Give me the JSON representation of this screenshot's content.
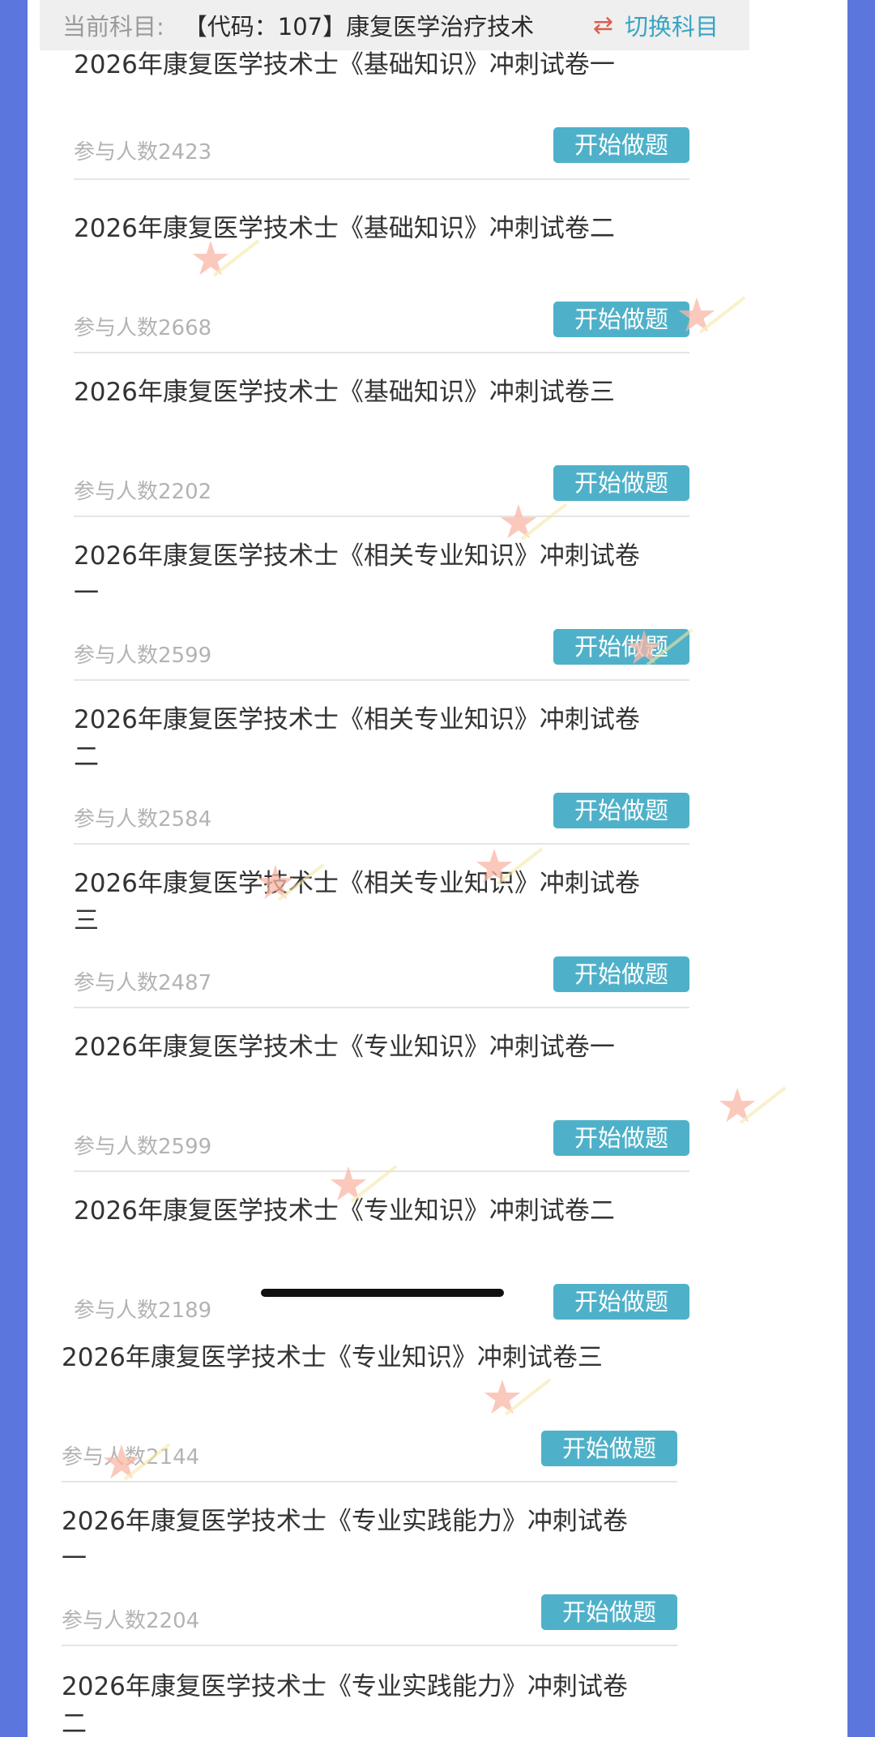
{
  "header": {
    "label": "当前科目:",
    "subject": "【代码：107】康复医学治疗技术",
    "switch_icon": "⇄",
    "switch_label": "切换科目"
  },
  "items": [
    {
      "title": "2026年康复医学技术士《基础知识》冲刺试卷一",
      "count": "参与人数2423",
      "button": "开始做题"
    },
    {
      "title": "2026年康复医学技术士《基础知识》冲刺试卷二",
      "count": "参与人数2668",
      "button": "开始做题"
    },
    {
      "title": "2026年康复医学技术士《基础知识》冲刺试卷三",
      "count": "参与人数2202",
      "button": "开始做题"
    },
    {
      "title": "2026年康复医学技术士《相关专业知识》冲刺试卷一",
      "count": "参与人数2599",
      "button": "开始做题"
    },
    {
      "title": "2026年康复医学技术士《相关专业知识》冲刺试卷二",
      "count": "参与人数2584",
      "button": "开始做题"
    },
    {
      "title": "2026年康复医学技术士《相关专业知识》冲刺试卷三",
      "count": "参与人数2487",
      "button": "开始做题"
    },
    {
      "title": "2026年康复医学技术士《专业知识》冲刺试卷一",
      "count": "参与人数2599",
      "button": "开始做题"
    },
    {
      "title": "2026年康复医学技术士《专业知识》冲刺试卷二",
      "count": "参与人数2189",
      "button": "开始做题"
    },
    {
      "title": "2026年康复医学技术士《专业知识》冲刺试卷三",
      "count": "参与人数2144",
      "button": "开始做题"
    },
    {
      "title": "2026年康复医学技术士《专业实践能力》冲刺试卷一",
      "count": "参与人数2204",
      "button": "开始做题"
    },
    {
      "title": "2026年康复医学技术士《专业实践能力》冲刺试卷二",
      "count": "",
      "button": ""
    }
  ],
  "colors": {
    "background": "#5b76dc",
    "panel": "#ffffff",
    "button": "#4fb1c9",
    "switch": "#36a5c3",
    "switch_icon": "#e15d4b"
  },
  "icons": {
    "switch": "swap-arrows-icon",
    "decoration": "star-sticker-icon"
  }
}
